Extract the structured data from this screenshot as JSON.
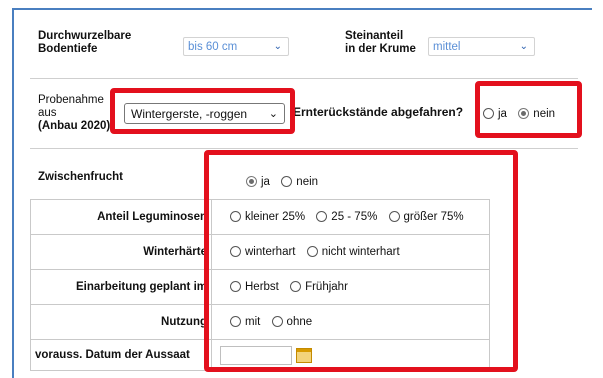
{
  "top_row": {
    "rooting_depth_label": "Durchwurzelbare\nBodentiefe",
    "rooting_depth_value": "bis 60 cm",
    "stone_label": "Steinanteil\nin der Krume",
    "stone_value": "mittel"
  },
  "sampling": {
    "label_line1": "Probenahme",
    "label_line2": "aus",
    "label_line3": "(Anbau 2020)",
    "crop_value": "Wintergerste, -roggen",
    "residues_question": "Ernterückstände abgefahren?",
    "residues_options": [
      "ja",
      "nein"
    ],
    "residues_selected": "nein"
  },
  "catch_crop": {
    "label": "Zwischenfrucht",
    "options": [
      "ja",
      "nein"
    ],
    "selected": "ja"
  },
  "details": [
    {
      "label": "Anteil Leguminosen",
      "options": [
        "kleiner 25%",
        "25 - 75%",
        "größer 75%"
      ]
    },
    {
      "label": "Winterhärte",
      "options": [
        "winterhart",
        "nicht winterhart"
      ]
    },
    {
      "label": "Einarbeitung geplant im",
      "options": [
        "Herbst",
        "Frühjahr"
      ]
    },
    {
      "label": "Nutzung",
      "options": [
        "mit",
        "ohne"
      ]
    }
  ],
  "sowing_date_label": "vorauss. Datum der Aussaat",
  "colors": {
    "highlight": "#e3101d",
    "link_blue": "#5a8fd6",
    "frame_blue": "#4a7fc0"
  },
  "icons": {
    "calendar": "calendar-icon",
    "chevron": "chevron-down-icon"
  }
}
